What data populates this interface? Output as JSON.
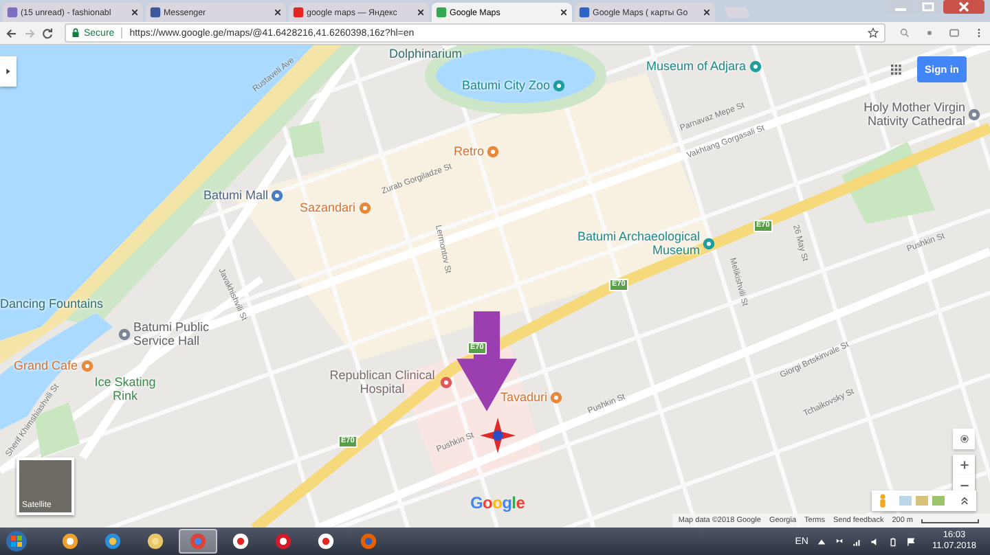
{
  "browser": {
    "tabs": [
      {
        "title": "(15 unread) - fashionabl",
        "kind": "mail",
        "selected": false
      },
      {
        "title": "Messenger",
        "kind": "facebook",
        "selected": false
      },
      {
        "title": "google maps — Яндекс",
        "kind": "yandex",
        "selected": false
      },
      {
        "title": "Google Maps",
        "kind": "maps",
        "selected": true
      },
      {
        "title": "Google Maps ( карты Go",
        "kind": "globe",
        "selected": false
      }
    ],
    "address_bar": {
      "security": "Secure",
      "url": "https://www.google.ge/maps/@41.6428216,41.6260398,16z?hl=en"
    }
  },
  "map": {
    "places": [
      {
        "name": "Dolphinarium",
        "kind": "landmark"
      },
      {
        "name": "Museum of Adjara",
        "kind": "museum"
      },
      {
        "name": "Batumi City Zoo",
        "kind": "museum"
      },
      {
        "name": "Holy Mother Virgin Nativity Cathedral",
        "kind": "church"
      },
      {
        "name": "Retro",
        "kind": "restaurant"
      },
      {
        "name": "Batumi Mall",
        "kind": "shopping"
      },
      {
        "name": "Sazandari",
        "kind": "restaurant"
      },
      {
        "name": "Batumi Archaeological Museum",
        "kind": "museum"
      },
      {
        "name": "Dancing Fountains",
        "kind": "landmark"
      },
      {
        "name": "Batumi Public Service Hall",
        "kind": "government"
      },
      {
        "name": "Grand Cafe",
        "kind": "restaurant"
      },
      {
        "name": "Ice Skating Rink",
        "kind": "park"
      },
      {
        "name": "Republican Clinical Hospital",
        "kind": "hospital"
      },
      {
        "name": "Tavaduri",
        "kind": "restaurant"
      }
    ],
    "streets": [
      {
        "name": "Rustaveli Ave"
      },
      {
        "name": "Zurab Gorgiladze St"
      },
      {
        "name": "Lermontov St"
      },
      {
        "name": "Javakhishvili St"
      },
      {
        "name": "Sherif Khimshiashvili St"
      },
      {
        "name": "Pushkin St"
      },
      {
        "name": "Pushkin St"
      },
      {
        "name": "Pushkin St"
      },
      {
        "name": "Melikishvili St"
      },
      {
        "name": "Parnavaz Mepe St"
      },
      {
        "name": "Vakhtang Gorgasali St"
      },
      {
        "name": "Giorgi Brtskinvale St"
      },
      {
        "name": "Tchaikovsky St"
      },
      {
        "name": "26 May St"
      }
    ],
    "road_badges": [
      "E70",
      "E70",
      "E70",
      "E70"
    ],
    "sign_in": "Sign in",
    "satellite_label": "Satellite",
    "logo": "Google",
    "footer": [
      "Map data ©2018 Google",
      "Georgia",
      "Terms",
      "Send feedback"
    ],
    "scale": "200 m"
  },
  "taskbar": {
    "apps": [
      {
        "kind": "media",
        "selected": false
      },
      {
        "kind": "ie",
        "selected": false
      },
      {
        "kind": "explorer",
        "selected": false
      },
      {
        "kind": "chrome",
        "selected": true
      },
      {
        "kind": "yandex",
        "selected": false
      },
      {
        "kind": "opera",
        "selected": false
      },
      {
        "kind": "yandex-browser",
        "selected": false
      },
      {
        "kind": "firefox",
        "selected": false
      }
    ],
    "language": "EN",
    "time": "16:03",
    "date": "11.07.2018"
  }
}
